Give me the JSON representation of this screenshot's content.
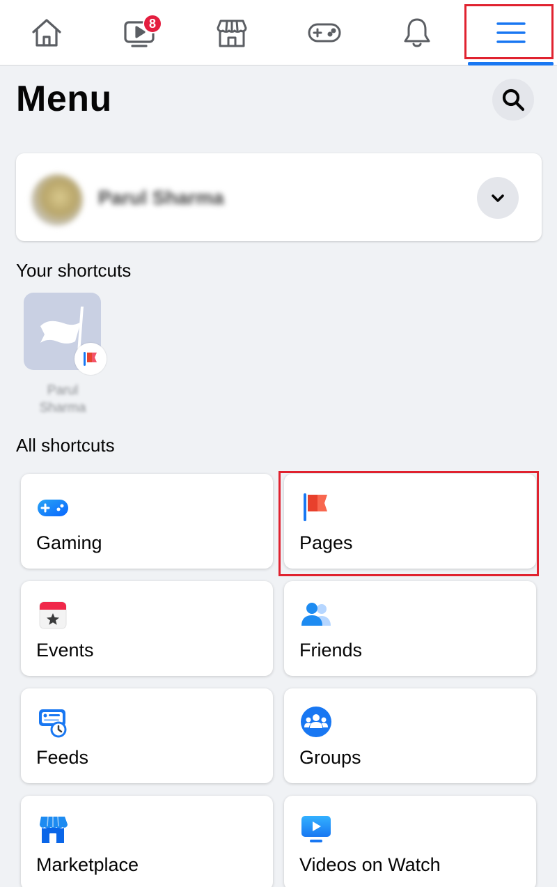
{
  "nav": {
    "items": [
      {
        "name": "home",
        "icon": "home-icon"
      },
      {
        "name": "watch",
        "icon": "video-icon",
        "badge": "8"
      },
      {
        "name": "marketplace",
        "icon": "shop-icon"
      },
      {
        "name": "gaming",
        "icon": "gamepad-icon"
      },
      {
        "name": "notifications",
        "icon": "bell-icon"
      },
      {
        "name": "menu",
        "icon": "hamburger-icon",
        "active": true
      }
    ],
    "accent_color": "#1877f2",
    "badge_color": "#e41e3f"
  },
  "header": {
    "title": "Menu"
  },
  "profile": {
    "name": "Parul Sharma"
  },
  "your_shortcuts": {
    "heading": "Your shortcuts",
    "items": [
      {
        "label": "Parul Sharma",
        "icon": "pages-flag-icon"
      }
    ]
  },
  "all_shortcuts": {
    "heading": "All shortcuts",
    "items": [
      {
        "label": "Gaming",
        "icon": "gaming-icon"
      },
      {
        "label": "Pages",
        "icon": "pages-flag-icon"
      },
      {
        "label": "Events",
        "icon": "calendar-icon"
      },
      {
        "label": "Friends",
        "icon": "friends-icon"
      },
      {
        "label": "Feeds",
        "icon": "feeds-icon"
      },
      {
        "label": "Groups",
        "icon": "groups-icon"
      },
      {
        "label": "Marketplace",
        "icon": "marketplace-icon"
      },
      {
        "label": "Videos on Watch",
        "icon": "watch-video-icon"
      }
    ]
  },
  "highlight_color": "#e0222f"
}
